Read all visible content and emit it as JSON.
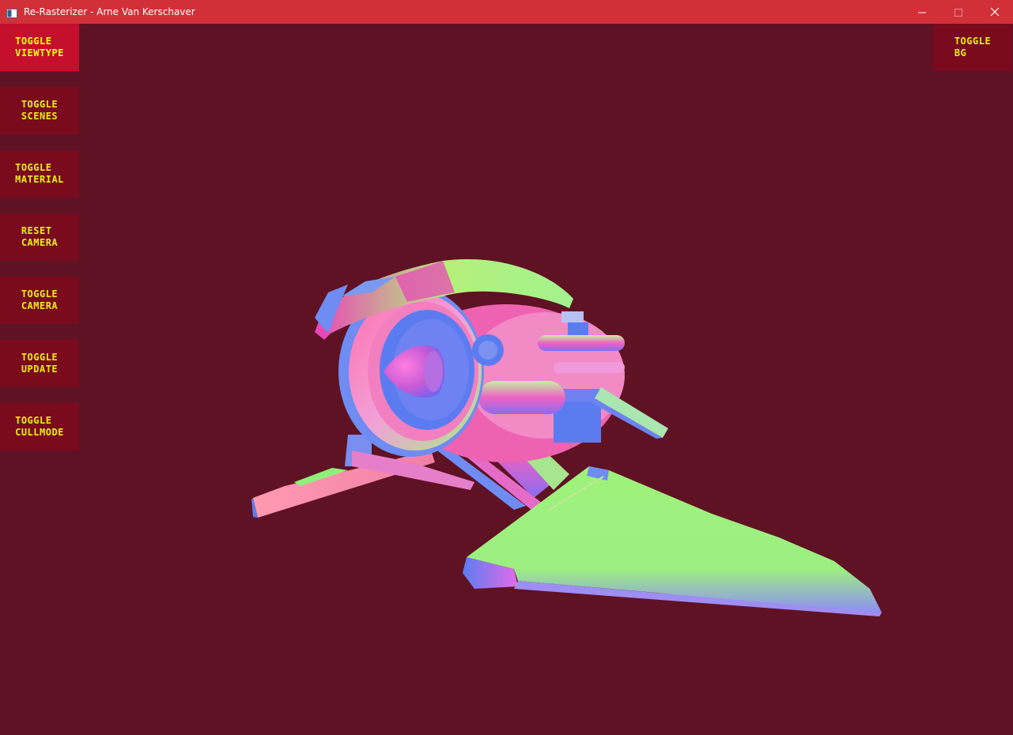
{
  "window": {
    "title": "Re-Rasterizer - Arne Van Kerschaver",
    "app_icon": "app-window-icon",
    "controls": [
      "minimize-icon",
      "maximize-icon",
      "close-icon"
    ]
  },
  "viewport": {
    "background_color": "#5f1224",
    "scene_object": "spaceship-model-normal-shaded"
  },
  "hud": {
    "left_buttons": [
      {
        "label": "TOGGLE\nVIEWTYPE",
        "active": true
      },
      {
        "label": "TOGGLE\nSCENES",
        "active": false
      },
      {
        "label": "TOGGLE\nMATERIAL",
        "active": false
      },
      {
        "label": "RESET\nCAMERA",
        "active": false
      },
      {
        "label": "TOGGLE\nCAMERA",
        "active": false
      },
      {
        "label": "TOGGLE\nUPDATE",
        "active": false
      },
      {
        "label": "TOGGLE\nCULLMODE",
        "active": false
      }
    ],
    "right_buttons": [
      {
        "label": "TOGGLE\nBG",
        "active": false
      }
    ],
    "button_color": "#7a0a1e",
    "active_button_color": "#c4102c",
    "text_color": "#e7f00a"
  }
}
